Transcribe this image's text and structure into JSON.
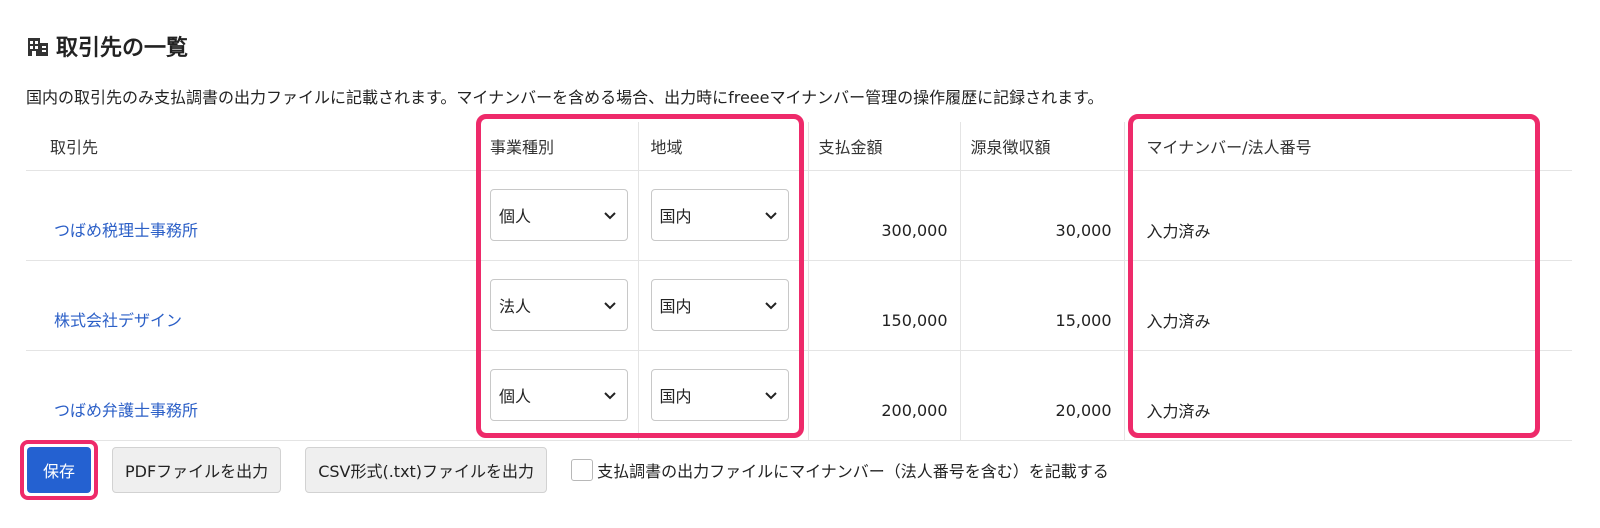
{
  "header": {
    "title": "取引先の一覧",
    "icon": "building-icon"
  },
  "description": "国内の取引先のみ支払調書の出力ファイルに記載されます。マイナンバーを含める場合、出力時にfreeeマイナンバー管理の操作履歴に記録されます。",
  "table": {
    "columns": [
      "取引先",
      "事業種別",
      "地域",
      "支払金額",
      "源泉徴収額",
      "マイナンバー/法人番号"
    ],
    "rows": [
      {
        "name": "つばめ税理士事務所",
        "type": "個人",
        "region": "国内",
        "amount": "300,000",
        "tax": "30,000",
        "mynumber": "入力済み"
      },
      {
        "name": "株式会社デザイン",
        "type": "法人",
        "region": "国内",
        "amount": "150,000",
        "tax": "15,000",
        "mynumber": "入力済み"
      },
      {
        "name": "つばめ弁護士事務所",
        "type": "個人",
        "region": "国内",
        "amount": "200,000",
        "tax": "20,000",
        "mynumber": "入力済み"
      }
    ]
  },
  "footer": {
    "save_label": "保存",
    "pdf_label": "PDFファイルを出力",
    "csv_label": "CSV形式(.txt)ファイルを出力",
    "checkbox_label": "支払調書の出力ファイルにマイナンバー（法人番号を含む）を記載する"
  },
  "colors": {
    "accent": "#2461d1",
    "highlight": "#ee2a6a",
    "link": "#2b5fc7"
  }
}
